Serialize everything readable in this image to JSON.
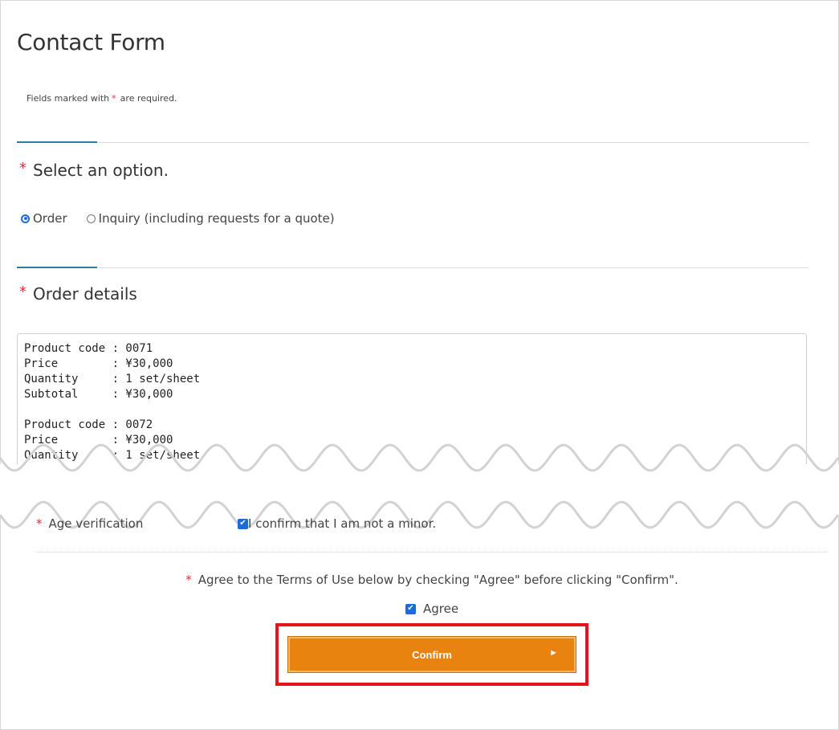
{
  "page": {
    "title": "Contact Form",
    "required_note_before": "Fields marked with",
    "required_star": "*",
    "required_note_after": "are required."
  },
  "option_section": {
    "star": "*",
    "heading": "Select an option.",
    "options": [
      {
        "label": "Order",
        "selected": true
      },
      {
        "label": "Inquiry (including requests for a quote)",
        "selected": false
      }
    ]
  },
  "order_section": {
    "star": "*",
    "heading": "Order details",
    "textarea_value": "Product code : 0071\nPrice        : ¥30,000\nQuantity     : 1 set/sheet\nSubtotal     : ¥30,000\n\nProduct code : 0072\nPrice        : ¥30,000\nQuantity     : 1 set/sheet"
  },
  "age_section": {
    "star": "*",
    "label": "Age verification",
    "checkbox_label": "I confirm that I am not a minor.",
    "checked": true
  },
  "terms_section": {
    "star": "*",
    "text": "Agree to the Terms of Use below by checking \"Agree\" before clicking \"Confirm\".",
    "agree_label": "Agree",
    "agree_checked": true
  },
  "confirm_button": {
    "label": "Confirm",
    "arrow": "►"
  },
  "colors": {
    "accent": "#2a7f99",
    "required": "#e0303a",
    "button": "#e8830f",
    "highlight": "#e8121b",
    "checkbox": "#1e6bd6"
  }
}
